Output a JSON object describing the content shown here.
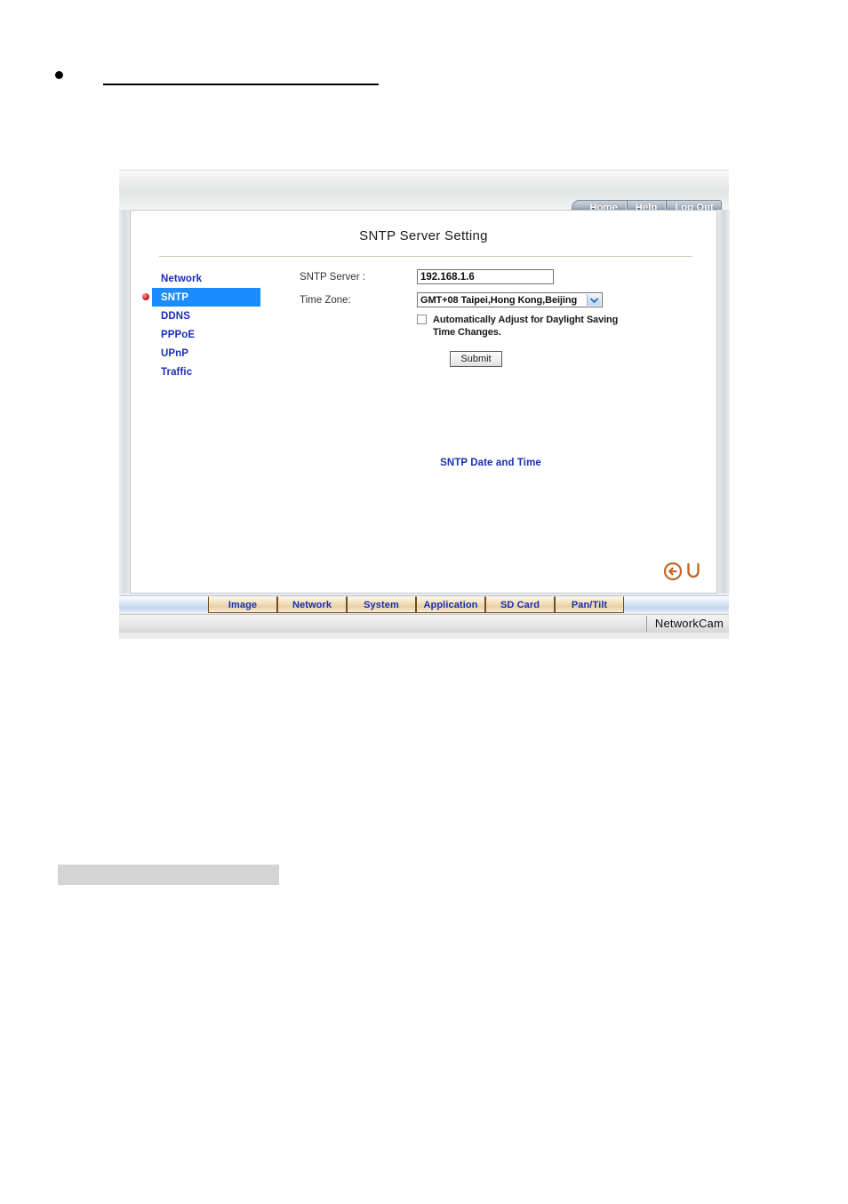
{
  "document": {
    "bullet": "•",
    "heading_text": ""
  },
  "device": {
    "topnav": {
      "items": [
        {
          "label": "Home",
          "name": "nav-home"
        },
        {
          "label": "Help",
          "name": "nav-help"
        },
        {
          "label": "Log Out",
          "name": "nav-logout"
        }
      ]
    },
    "page_title": "SNTP Server Setting",
    "sidebar": {
      "items": [
        {
          "label": "Network",
          "active": false
        },
        {
          "label": "SNTP",
          "active": true
        },
        {
          "label": "DDNS",
          "active": false
        },
        {
          "label": "PPPoE",
          "active": false
        },
        {
          "label": "UPnP",
          "active": false
        },
        {
          "label": "Traffic",
          "active": false
        }
      ]
    },
    "form": {
      "sntp_server_label": "SNTP Server :",
      "sntp_server_value": "192.168.1.6",
      "time_zone_label": "Time Zone:",
      "time_zone_value": "GMT+08 Taipei,Hong Kong,Beijing",
      "time_zone_options": [
        "GMT+08 Taipei,Hong Kong,Beijing"
      ],
      "dst_label": "Automatically Adjust for Daylight Saving Time Changes.",
      "dst_checked": false,
      "submit_label": "Submit"
    },
    "status_text": "SNTP Date and Time",
    "page_icons": {
      "back": "back-arrow-icon",
      "refresh": "refresh-icon"
    },
    "tabs": [
      {
        "label": "Image"
      },
      {
        "label": "Network"
      },
      {
        "label": "System"
      },
      {
        "label": "Application"
      },
      {
        "label": "SD Card"
      },
      {
        "label": "Pan/Tilt"
      }
    ],
    "brand": "NetworkCam"
  },
  "colors": {
    "link_blue": "#1a2fb4",
    "active_highlight": "#1a8cff",
    "tab_tan": "#e7d0a4",
    "tab_border_brown": "#7a4a18",
    "icon_orange": "#c2662a",
    "status_dot_red": "#d3232b"
  }
}
